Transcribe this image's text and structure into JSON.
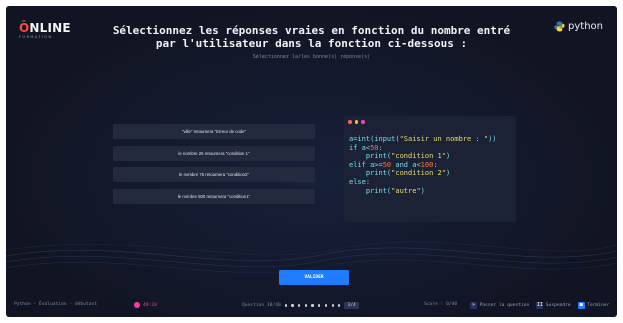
{
  "brand": {
    "logo_text": "NLINE",
    "logo_letter": "Ô",
    "tagline": "FORMATION",
    "partner": "python",
    "partner_icon": "python-logo-icon"
  },
  "question": {
    "title": "Sélectionnez les réponses vraies en fonction du nombre entré par l'utilisateur dans la fonction ci-dessous :",
    "instruction": "Sélectionnez la/les bonne(s) réponse(s)"
  },
  "answers": [
    {
      "label": "\"ville\" retournera \"Erreur de code\""
    },
    {
      "label": "le nombre 25 retournera \"condition 1\""
    },
    {
      "label": "le nombre 75 retournera \"condition2\""
    },
    {
      "label": "le nombre 500 retournera \"condition1\""
    }
  ],
  "code": {
    "line1_a": "a=int(input(",
    "line1_s": "\"Saisir un nombre : \"",
    "line1_b": "))",
    "line2_a": "if a<",
    "line2_n": "50",
    "line2_b": ":",
    "line3_a": "    print(",
    "line3_s": "\"condition 1\"",
    "line3_b": ")",
    "line4_a": "elif a>=",
    "line4_n1": "50",
    "line4_b": " and a<",
    "line4_n2": "100",
    "line4_c": ":",
    "line5_a": "    print(",
    "line5_s": "\"condition 2\"",
    "line5_b": ")",
    "line6": "else:",
    "line7_a": "    print(",
    "line7_s": "\"autre\"",
    "line7_b": ")"
  },
  "window_dots_colors": [
    "#ff5f57",
    "#ffbd2e",
    "#ff3aa8"
  ],
  "validate_label": "VALIDER",
  "footer": {
    "course": "Python - Évaluation - débutant",
    "timer": "49:28",
    "question_counter": "Question 18/40",
    "progress_badge": "3/4",
    "score": "Score : 0/40",
    "skip": "Passer la question",
    "suspend": "Suspendre",
    "finish": "Terminer"
  },
  "colors": {
    "background": "#111523",
    "accent": "#1f7bff",
    "timer": "#ff3aa8",
    "brand_o": "#ff4a3d"
  }
}
